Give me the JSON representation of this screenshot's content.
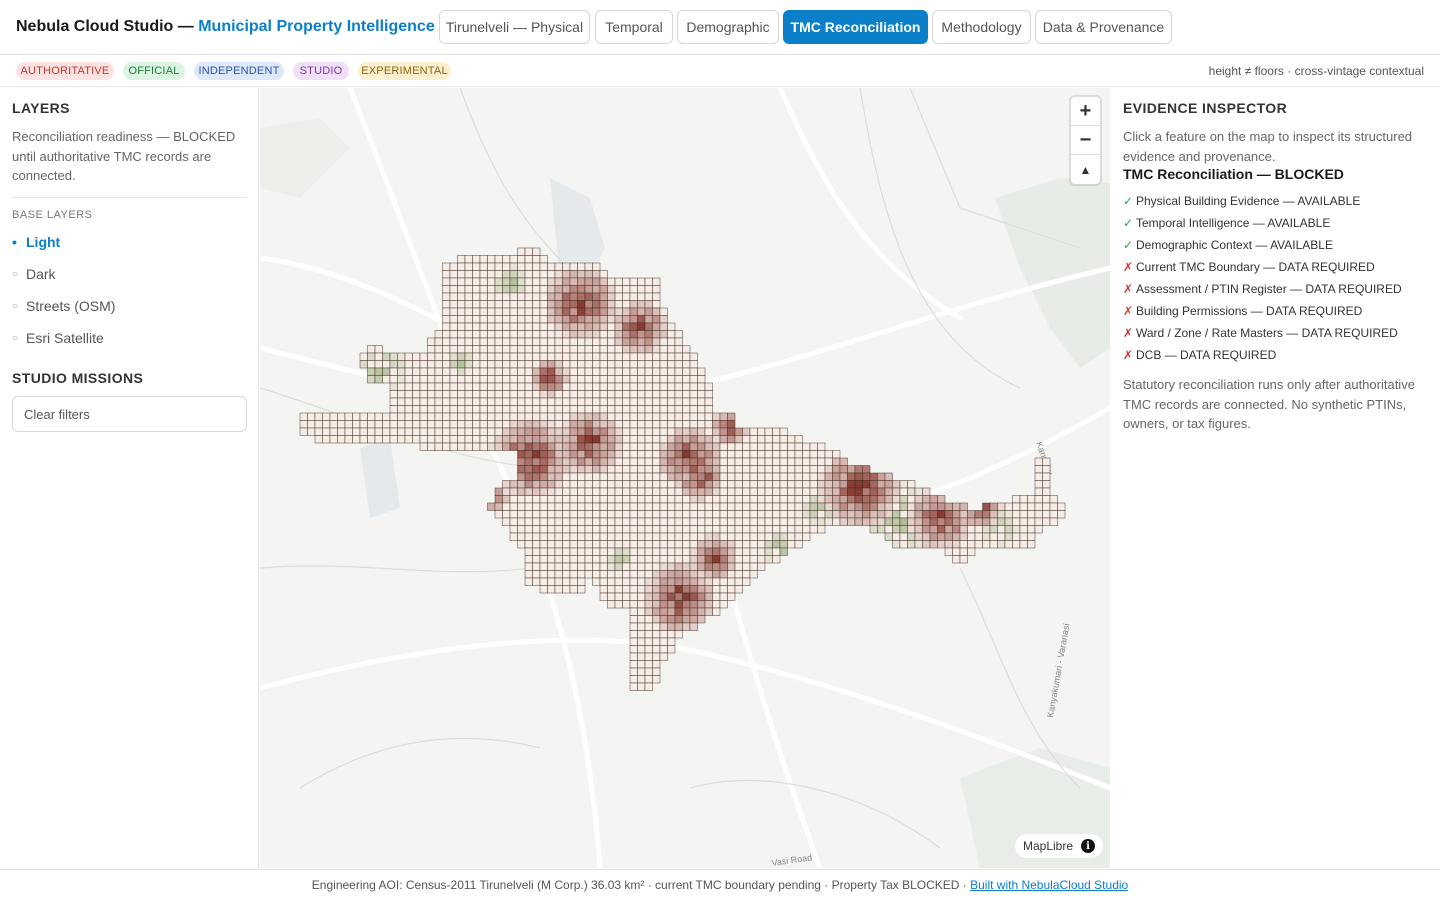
{
  "header": {
    "brand": "Nebula Cloud Studio — ",
    "brand_sub": "Municipal Property Intelligence",
    "tabs": [
      {
        "label": "Tirunelveli — Physical",
        "active": false
      },
      {
        "label": "Temporal",
        "active": false
      },
      {
        "label": "Demographic",
        "active": false
      },
      {
        "label": "TMC Reconciliation",
        "active": true
      },
      {
        "label": "Methodology",
        "active": false
      },
      {
        "label": "Data & Provenance",
        "active": false
      }
    ]
  },
  "legend": {
    "badges": [
      {
        "label": "AUTHORITATIVE",
        "bg": "#fde2e2",
        "fg": "#c0392b"
      },
      {
        "label": "OFFICIAL",
        "bg": "#dcf5e3",
        "fg": "#1e7a3c"
      },
      {
        "label": "INDEPENDENT",
        "bg": "#dde8fb",
        "fg": "#2a55a8"
      },
      {
        "label": "STUDIO",
        "bg": "#efe0f7",
        "fg": "#7b3a9c"
      },
      {
        "label": "EXPERIMENTAL",
        "bg": "#fdf0cf",
        "fg": "#8a6410"
      }
    ],
    "note": "height ≠ floors · cross-vintage contextual"
  },
  "layers_panel": {
    "title": "LAYERS",
    "readiness": "Reconciliation readiness — BLOCKED until authoritative TMC records are connected.",
    "base_layers_heading": "BASE LAYERS",
    "base_layers": [
      {
        "label": "Light",
        "active": true
      },
      {
        "label": "Dark",
        "active": false
      },
      {
        "label": "Streets (OSM)",
        "active": false
      },
      {
        "label": "Esri Satellite",
        "active": false
      }
    ],
    "missions_title": "STUDIO MISSIONS",
    "clear_filters": "Clear filters"
  },
  "map": {
    "zoom_in": "+",
    "zoom_out": "−",
    "compass": "▲",
    "attribution": "MapLibre",
    "info_icon": "i",
    "road_labels": [
      "Kanyakumari - Varanasi",
      "Vasi Road",
      "Kanyaku"
    ],
    "colors": {
      "background": "#f4f4f2",
      "cell_light": "#f6ece6",
      "cell_dense": "#8b3a32",
      "cell_green": "#aabd93",
      "cell_stroke": "#3a2a22"
    }
  },
  "inspector": {
    "title": "EVIDENCE INSPECTOR",
    "hint": "Click a feature on the map to inspect its structured evidence and provenance.",
    "status_title": "TMC Reconciliation — BLOCKED",
    "items": [
      {
        "mark": "✓",
        "label": "Physical Building Evidence — AVAILABLE",
        "ok": true
      },
      {
        "mark": "✓",
        "label": "Temporal Intelligence — AVAILABLE",
        "ok": true
      },
      {
        "mark": "✓",
        "label": "Demographic Context — AVAILABLE",
        "ok": true
      },
      {
        "mark": "✗",
        "label": "Current TMC Boundary — DATA REQUIRED",
        "ok": false
      },
      {
        "mark": "✗",
        "label": "Assessment / PTIN Register — DATA REQUIRED",
        "ok": false
      },
      {
        "mark": "✗",
        "label": "Building Permissions — DATA REQUIRED",
        "ok": false
      },
      {
        "mark": "✗",
        "label": "Ward / Zone / Rate Masters — DATA REQUIRED",
        "ok": false
      },
      {
        "mark": "✗",
        "label": "DCB — DATA REQUIRED",
        "ok": false
      }
    ],
    "footnote": "Statutory reconciliation runs only after authoritative TMC records are connected. No synthetic PTINs, owners, or tax figures."
  },
  "footer": {
    "text": "Engineering AOI: Census-2011 Tirunelveli (M Corp.) 36.03 km² · current TMC boundary pending · Property Tax BLOCKED ·",
    "link": "Built with NebulaCloud Studio"
  }
}
